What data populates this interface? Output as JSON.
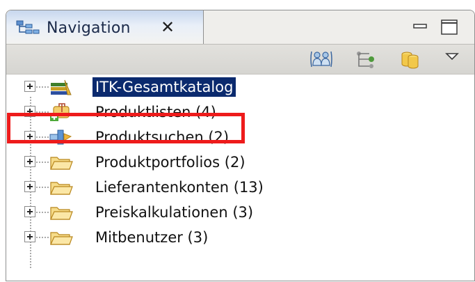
{
  "view": {
    "tab_title": "Navigation",
    "close_glyph": "✕",
    "icons": {
      "tab": "navigation-view-icon",
      "minimize": "minimize-icon",
      "maximize": "maximize-icon",
      "toolbar": [
        "people-icon",
        "tree-structure-icon",
        "database-icon",
        "view-menu-icon"
      ]
    }
  },
  "tree": {
    "items": [
      {
        "label": "ITK-Gesamtkatalog",
        "icon": "catalog-icon",
        "selected": true
      },
      {
        "label": "Produktlisten (4)",
        "icon": "product-list-icon",
        "selected": false
      },
      {
        "label": "Produktsuchen (2)",
        "icon": "product-search-icon",
        "selected": false
      },
      {
        "label": "Produktportfolios (2)",
        "icon": "folder-icon",
        "selected": false
      },
      {
        "label": "Lieferantenkonten (13)",
        "icon": "folder-icon",
        "selected": false
      },
      {
        "label": "Preiskalkulationen (3)",
        "icon": "folder-icon",
        "selected": false
      },
      {
        "label": "Mitbenutzer (3)",
        "icon": "folder-icon",
        "selected": false
      }
    ]
  },
  "colors": {
    "selection": "#0b2a6e",
    "annotation_red": "#ee1b1b",
    "folder": "#f5c659"
  }
}
